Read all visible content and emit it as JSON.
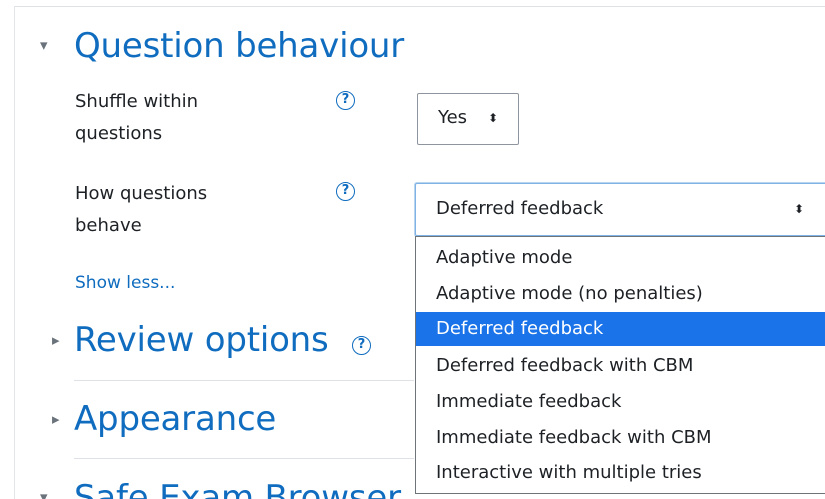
{
  "sections": {
    "question_behaviour": {
      "title": "Question behaviour",
      "caret": "▾"
    },
    "review_options": {
      "title": "Review options",
      "caret": "▸",
      "help": "?"
    },
    "appearance": {
      "title": "Appearance",
      "caret": "▸"
    },
    "safe_exam_browser": {
      "title": "Safe Exam Browser",
      "caret": "▾"
    }
  },
  "fields": {
    "shuffle": {
      "label_line1": "Shuffle within",
      "label_line2": "questions",
      "help": "?",
      "value": "Yes",
      "arrows": "⬍"
    },
    "behave": {
      "label_line1": "How questions",
      "label_line2": "behave",
      "help": "?",
      "value": "Deferred feedback",
      "arrows": "⬍"
    }
  },
  "show_less": "Show less...",
  "dropdown": {
    "options": [
      "Adaptive mode",
      "Adaptive mode (no penalties)",
      "Deferred feedback",
      "Deferred feedback with CBM",
      "Immediate feedback",
      "Immediate feedback with CBM",
      "Interactive with multiple tries"
    ],
    "selected": "Deferred feedback"
  },
  "icons": {
    "help": "help-icon",
    "collapse": "caret-down-icon",
    "expand": "caret-right-icon",
    "select_arrows": "select-arrows-icon"
  },
  "colors": {
    "link": "#0f6cbf",
    "selected_option": "#1a73e8",
    "text": "#1d2125"
  }
}
